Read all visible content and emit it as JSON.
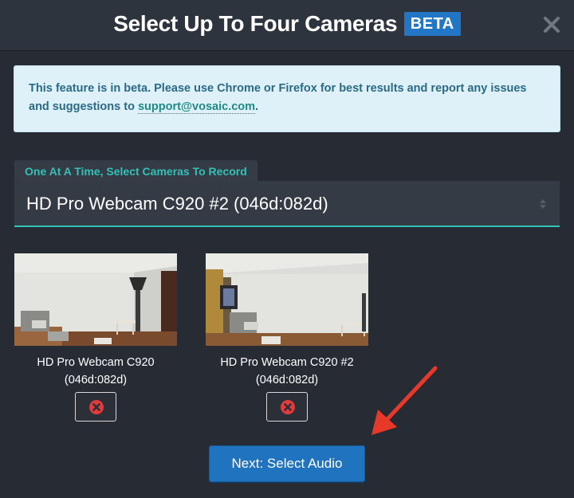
{
  "header": {
    "title": "Select Up To Four Cameras",
    "badge": "BETA"
  },
  "notice": {
    "text": "This feature is in beta. Please use Chrome or Firefox for best results and report any issues and suggestions to ",
    "email": "support@vosaic.com",
    "suffix": "."
  },
  "camera_select": {
    "label": "One At A Time, Select Cameras To Record",
    "value": "HD Pro Webcam C920 #2 (046d:082d)"
  },
  "cameras": [
    {
      "name": "HD Pro Webcam C920",
      "id": "(046d:082d)"
    },
    {
      "name": "HD Pro Webcam C920 #2",
      "id": "(046d:082d)"
    }
  ],
  "next_button": {
    "label": "Next: Select Audio"
  },
  "colors": {
    "background": "#262b34",
    "accent_teal": "#33c0b6",
    "button_blue": "#1f73bf",
    "annotation_red": "#e8382a"
  },
  "icons": {
    "close": "close-icon",
    "remove": "remove-circle-icon",
    "select": "select-arrows-icon",
    "annotation": "red-arrow-icon"
  }
}
